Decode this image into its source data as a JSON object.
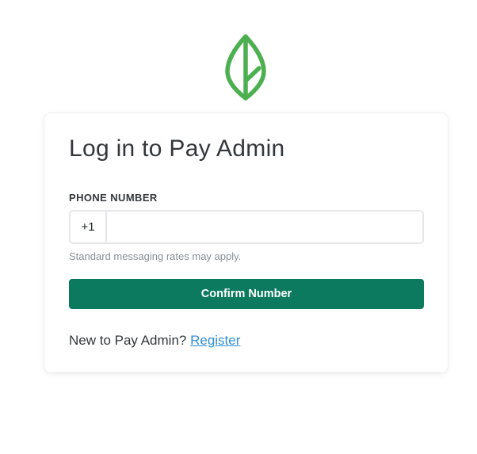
{
  "logo": {
    "icon": "leaf-icon",
    "color": "#4caf50"
  },
  "login": {
    "title": "Log in to Pay Admin",
    "phone_label": "PHONE NUMBER",
    "country_code": "+1",
    "phone_value": "",
    "phone_placeholder": "",
    "hint": "Standard messaging rates may apply.",
    "confirm_label": "Confirm Number",
    "register_prompt": "New to Pay Admin?",
    "register_link": "Register"
  },
  "colors": {
    "primary_button": "#0c7a5f",
    "link": "#2d8fd5"
  }
}
